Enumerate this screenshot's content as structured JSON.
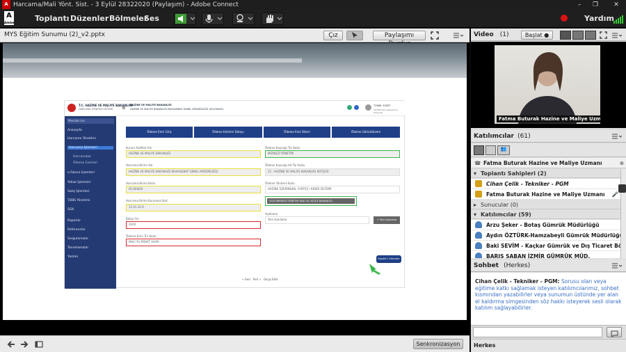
{
  "window": {
    "title": "Harcama/Mali Yönt. Sist. - 3 Eylül 28322020 (Paylaşım) - Adobe Connect",
    "logo": "Adobe"
  },
  "menu": {
    "items": [
      "Toplantı",
      "Düzenler",
      "Bölmeler",
      "Ses"
    ],
    "help": "Yardım"
  },
  "share": {
    "title": "MYS Eğitim Sunumu (2)_v2.pptx",
    "exit_label": "Çız",
    "stop_label": "Paylaşımı Durdur",
    "sync_label": "Senkronizasyon"
  },
  "slide": {
    "org_line1": "T.C. HAZİNE VE MALİYE BAKANLIĞI",
    "org_line2": "HARCAMA YÖNETİM SİSTEMİ",
    "header_center_1": "HAZİNE VE MALİYE BAKANLIĞI",
    "header_center_2": "HAZİNE VE MALİYE BAKANLIĞI MUHASEBAT GENEL MÜDÜRLÜĞÜ (61100000)",
    "header_right_1": "TOMKL YÜZET",
    "header_right_2": "SİSTEM Gerçekleştirme Görevlisi",
    "sidebar_search": "Menüde ara",
    "sidebar_items": [
      "Anasayfa",
      "Harcama Yönetimi",
      "Harcama İşlemleri",
      "Harcamalar",
      "Ödeme Emirleri",
      "e-Fatura İşlemleri",
      "Yolluk İşlemleri",
      "Satış İşlemleri",
      "TDBS Yönetimi",
      "SGK",
      "Raporlar",
      "Referanslar",
      "Sorgulamalar",
      "Tanımlamalar",
      "Yardım"
    ],
    "steps": [
      "Ödeme Emri Giriş",
      "Ödeme Emirleri Detayı",
      "Ödeme Emri Ekleri",
      "Ödeme Görüntüleme"
    ],
    "left_fields": [
      {
        "label": "Kurum Adı/Kod Adı",
        "value": "HAZİNE VE MALİYE BAKANLIĞI"
      },
      {
        "label": "Harcama Birimi Adı",
        "value": "HAZİNE VE MALİYE BAKANLIĞI MUHASEBAT GENEL MÜDÜRLÜĞÜ"
      },
      {
        "label": "Harcama Birimi Kodu",
        "value": "61100000"
      },
      {
        "label": "Harcama Birimi Kurumsal Kod",
        "value": "12.01.32.9"
      }
    ],
    "year_label": "Bütçe Yılı",
    "year_value": "2020",
    "type_label": "Ödeme Emri Tür Kodu",
    "type_value": "MALİ YIL MÜHİT ALMA",
    "right_fields": [
      {
        "label": "Ödeme Kaynağı Tür Kodu",
        "value": "MERKEZİ YÖNETİM"
      },
      {
        "label": "Ödeme Kaynağı Alt Tür Kodu",
        "value": "12 - HAZİNE VE MALİYE BAKANLIĞI BÜTÇESİ"
      },
      {
        "label": "Ödeme Yöntemi Kodu",
        "value": "HAZİNE ÜZERİNDEN, YURTİÇİ / KENDİ SİSTEMİ"
      }
    ],
    "chip": "2020 MERKEZİ YÖNETİM MALİ YIL BÜTÇE BAKANLIĞI",
    "desc_label": "Açıklama",
    "desc_placeholder": "Yeni Açıklama",
    "desc_btn": "+ Yeni Açıklama",
    "save_btn": "Kaydet / Güncelle",
    "pager": "« Geri   İleri »   Geçiş Ekle"
  },
  "video": {
    "title": "Video",
    "count": "(1)",
    "start_label": "Başlat",
    "caption": "Fatma Buturak Hazine ve Maliye Uzmanı"
  },
  "attendees": {
    "title": "Katılımcılar",
    "count": "(61)",
    "speaker": "Fatma Buturak Hazine ve Maliye Uzmanı",
    "hosts_label": "Toplantı Sahipleri (2)",
    "hosts": [
      "Cihan Çelik - Tekniker - PGM",
      "Fatma Buturak Hazine ve Maliye Uzmanı"
    ],
    "presenters_label": "Sunucular (0)",
    "participants_label": "Katılımcılar (59)",
    "participants": [
      "Arzu Şeker - Botaş Gümrük Müdürlüğü",
      "Aydın ÖZTÜRK-Hamzabeyli Gümrük Müdürlüğü",
      "Baki SEVİM - Kaçkar Gümrük ve Dış Ticaret Bölge Mü...",
      "BARIŞ SABAN İZMİR GÜMRÜK MÜD."
    ]
  },
  "chat": {
    "title": "Sohbet",
    "scope": "(Herkes)",
    "sender": "Cihan Çelik - Tekniker - PGM:",
    "message": "Sorusu olan veya eğitime katkı sağlamak isteyen katılımcılarımız, sohbet kısmından yazabilirler veya sunumun üstünde yer alan el kaldırma simgesinden söz hakkı isteyerek sesli olarak katılım sağlayabilirler.",
    "footer": "Herkes"
  },
  "colors": {
    "sidebar": "#243a73",
    "step_bar": "#1f3f86",
    "accent_yellow": "#e8e03a",
    "accent_green": "#39b54a",
    "accent_red": "#d8262c",
    "chat_text": "#3a6fc4"
  }
}
